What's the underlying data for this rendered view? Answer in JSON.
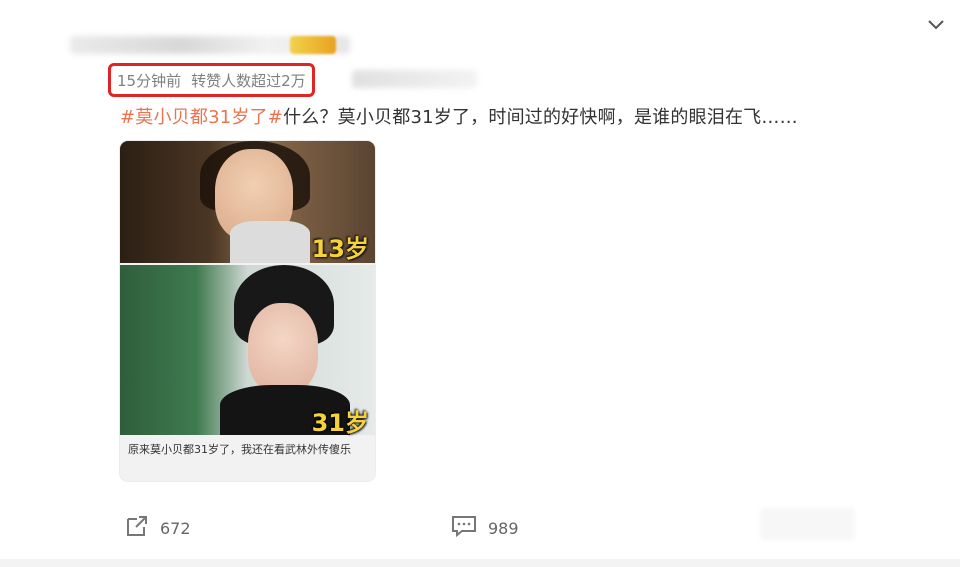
{
  "post": {
    "meta": {
      "time": "15分钟前",
      "repost_info": "转赞人数超过2万"
    },
    "text": {
      "hashtag": "#莫小贝都31岁了#",
      "body": "什么？莫小贝都31岁了，时间过的好快啊，是谁的眼泪在飞……"
    },
    "media": {
      "top_age_label": "13岁",
      "bottom_age_label": "31岁",
      "caption": "原来莫小贝都31岁了，我还在看武林外传傻乐"
    }
  },
  "footer": {
    "repost_count": "672",
    "comment_count": "989"
  },
  "colors": {
    "hashtag": "#eb7350",
    "highlight_border": "#e02424"
  },
  "icons": [
    "chevron-down-icon",
    "share-icon",
    "comment-icon"
  ]
}
